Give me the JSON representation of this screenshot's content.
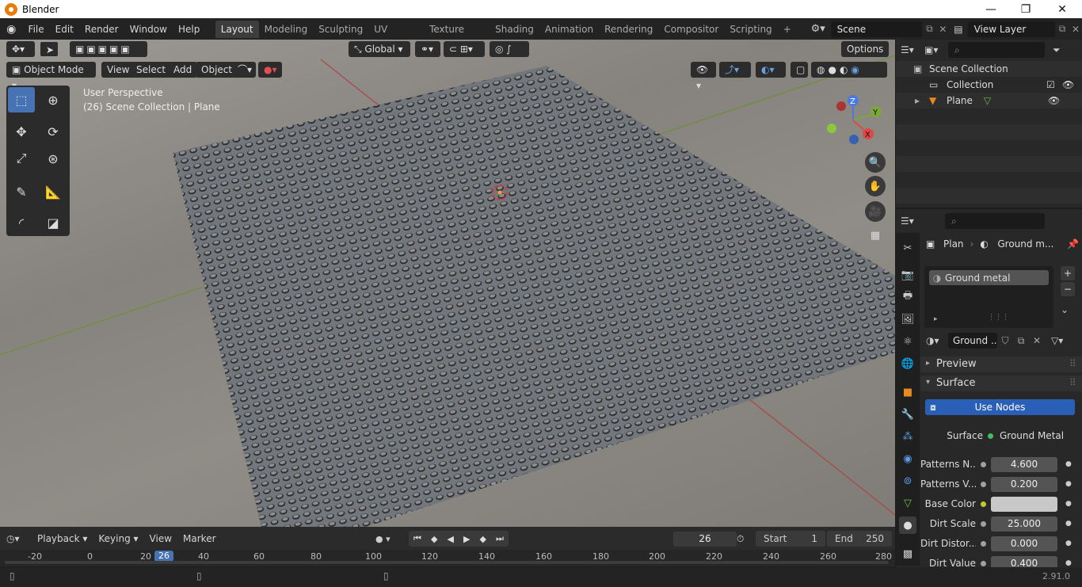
{
  "window": {
    "title": "Blender",
    "min": "—",
    "max": "❐",
    "close": "✕"
  },
  "menus": [
    "File",
    "Edit",
    "Render",
    "Window",
    "Help"
  ],
  "workspaces": [
    {
      "label": "Layout",
      "active": true
    },
    {
      "label": "Modeling"
    },
    {
      "label": "Sculpting"
    },
    {
      "label": "UV Editing"
    },
    {
      "label": "Texture Paint"
    },
    {
      "label": "Shading"
    },
    {
      "label": "Animation"
    },
    {
      "label": "Rendering"
    },
    {
      "label": "Compositor"
    },
    {
      "label": "Scripting"
    }
  ],
  "add_workspace": "+",
  "scene": {
    "value": "Scene"
  },
  "view_layer": {
    "value": "View Layer"
  },
  "header": {
    "transform": "Global",
    "options": "Options",
    "mode": "Object Mode",
    "view": "View",
    "select": "Select",
    "add": "Add",
    "object": "Object"
  },
  "viewport": {
    "line1": "User Perspective",
    "line2": "(26) Scene Collection | Plane"
  },
  "gizmo": {
    "z": "Z",
    "y": "Y",
    "x": "X"
  },
  "outliner": {
    "root": "Scene Collection",
    "collection": "Collection",
    "object": "Plane"
  },
  "props": {
    "breadcrumb_obj": "Plan",
    "breadcrumb_mat": "Ground m...",
    "slot": "Ground metal",
    "material_field": "Ground ...",
    "preview": "Preview",
    "surface_section": "Surface",
    "use_nodes": "Use Nodes",
    "surface_label": "Surface",
    "surface_value": "Ground Metal",
    "inputs": [
      {
        "label": "Patterns N...",
        "value": "4.600"
      },
      {
        "label": "Patterns V...",
        "value": "0.200"
      },
      {
        "label": "Base Color",
        "value": "",
        "color": "#c8c8c8"
      },
      {
        "label": "Dirt Scale",
        "value": "25.000"
      },
      {
        "label": "Dirt Distor...",
        "value": "0.000"
      },
      {
        "label": "Dirt Value",
        "value": "0.400"
      }
    ]
  },
  "timeline": {
    "playback": "Playback",
    "keying": "Keying",
    "view": "View",
    "marker": "Marker",
    "current": "26",
    "start_label": "Start",
    "start": "1",
    "end_label": "End",
    "end": "250"
  },
  "ruler": [
    "-20",
    "0",
    "20",
    "26",
    "40",
    "60",
    "80",
    "100",
    "120",
    "140",
    "160",
    "180",
    "200",
    "220",
    "240",
    "260",
    "280"
  ],
  "status": {
    "version": "2.91.0"
  },
  "colors": {
    "accent": "#4772b3",
    "use_nodes": "#2a5fb8",
    "bg": "#1d1d1d"
  }
}
